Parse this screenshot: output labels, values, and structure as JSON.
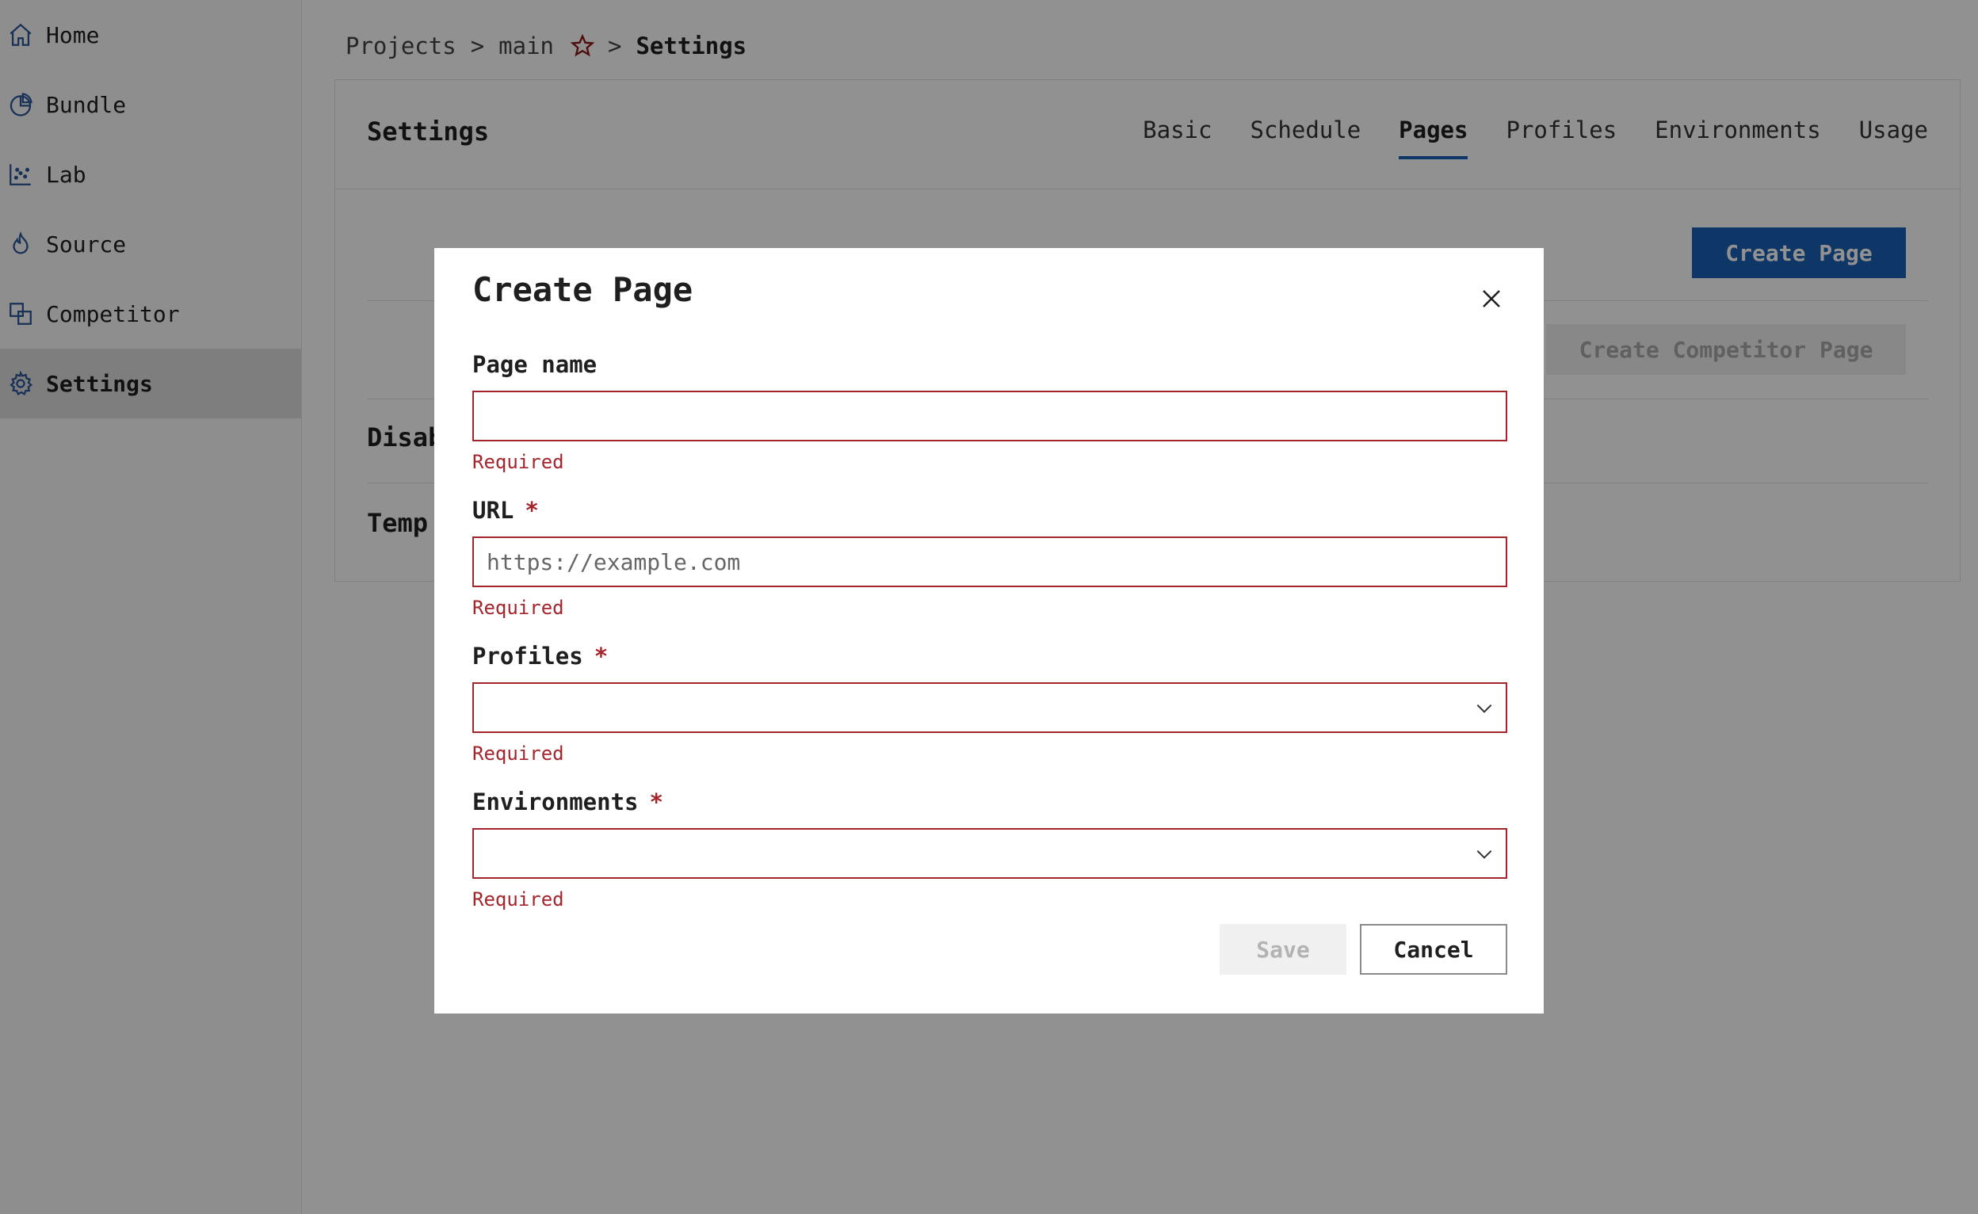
{
  "sidebar": {
    "items": [
      {
        "label": "Home",
        "icon": "home-icon"
      },
      {
        "label": "Bundle",
        "icon": "pie-chart-icon"
      },
      {
        "label": "Lab",
        "icon": "scatter-chart-icon"
      },
      {
        "label": "Source",
        "icon": "flame-icon"
      },
      {
        "label": "Competitor",
        "icon": "compare-icon"
      },
      {
        "label": "Settings",
        "icon": "gear-icon",
        "active": true
      }
    ]
  },
  "breadcrumb": {
    "projects": "Projects",
    "sep1": ">",
    "project": "main",
    "sep2": ">",
    "current": "Settings"
  },
  "settings": {
    "title": "Settings",
    "tabs": [
      "Basic",
      "Schedule",
      "Pages",
      "Profiles",
      "Environments",
      "Usage"
    ],
    "active_tab": "Pages",
    "create_page_button": "Create Page",
    "create_competitor_page_button": "Create Competitor Page",
    "row_disabled_partial": "Disab",
    "row_temp_partial": "Temp"
  },
  "modal": {
    "title": "Create Page",
    "page_name": {
      "label": "Page name",
      "value": "",
      "placeholder": "",
      "error": "Required"
    },
    "url": {
      "label": "URL",
      "required_mark": "*",
      "value": "",
      "placeholder": "https://example.com",
      "error": "Required"
    },
    "profiles": {
      "label": "Profiles",
      "required_mark": "*",
      "error": "Required"
    },
    "environments": {
      "label": "Environments",
      "required_mark": "*",
      "error": "Required"
    },
    "save_button": "Save",
    "cancel_button": "Cancel"
  },
  "colors": {
    "accent": "#1a5fb4",
    "error": "#a4262c",
    "overlay": "rgba(0,0,0,0.43)",
    "star": "#8b1a1a"
  }
}
